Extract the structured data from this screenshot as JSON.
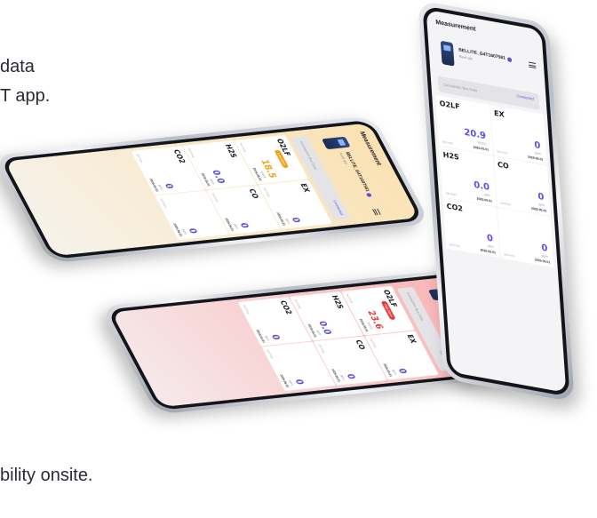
{
  "copy": {
    "line1": "data",
    "line2": "T app.",
    "line3": "bility onsite."
  },
  "screen": {
    "title": "Measurement",
    "device_name": "BELLITE_G4T1607561",
    "device_sub": "Read app",
    "connection_label": "Connection Bus Data",
    "connection_status": "Connected",
    "date": "2025.05.01",
    "unit": "%VOL",
    "unit_ppm": "ppm",
    "unit_lel": "%LEL",
    "small_label": "Set Point"
  },
  "phones": {
    "right": {
      "cells": [
        {
          "gas": "O2LF",
          "value": "20.9",
          "status": "normal"
        },
        {
          "gas": "EX",
          "value": "0",
          "status": "normal"
        },
        {
          "gas": "H2S",
          "value": "0.0",
          "status": "normal"
        },
        {
          "gas": "CO",
          "value": "0",
          "status": "normal"
        },
        {
          "gas": "CO2",
          "value": "0",
          "status": "normal"
        },
        {
          "gas": "",
          "value": "0",
          "status": "normal"
        }
      ]
    },
    "left": {
      "badge": "Low Alarm",
      "cells": [
        {
          "gas": "O2LF",
          "value": "18.5",
          "status": "warn"
        },
        {
          "gas": "EX",
          "value": "0",
          "status": "normal"
        },
        {
          "gas": "H2S",
          "value": "0.0",
          "status": "normal"
        },
        {
          "gas": "CO",
          "value": "0",
          "status": "normal"
        },
        {
          "gas": "CO2",
          "value": "0",
          "status": "normal"
        },
        {
          "gas": "",
          "value": "0",
          "status": "normal"
        }
      ]
    },
    "bottom": {
      "badge": "High Alarm",
      "cells": [
        {
          "gas": "O2LF",
          "value": "23.6",
          "status": "alarm"
        },
        {
          "gas": "EX",
          "value": "0",
          "status": "normal"
        },
        {
          "gas": "H2S",
          "value": "0.0",
          "status": "normal"
        },
        {
          "gas": "CO",
          "value": "0",
          "status": "normal"
        },
        {
          "gas": "CO2",
          "value": "0",
          "status": "normal"
        },
        {
          "gas": "",
          "value": "0",
          "status": "normal"
        }
      ]
    }
  },
  "colors": {
    "accent": "#5a4fe0",
    "warn": "#f0a213",
    "alarm": "#e83a3a"
  }
}
